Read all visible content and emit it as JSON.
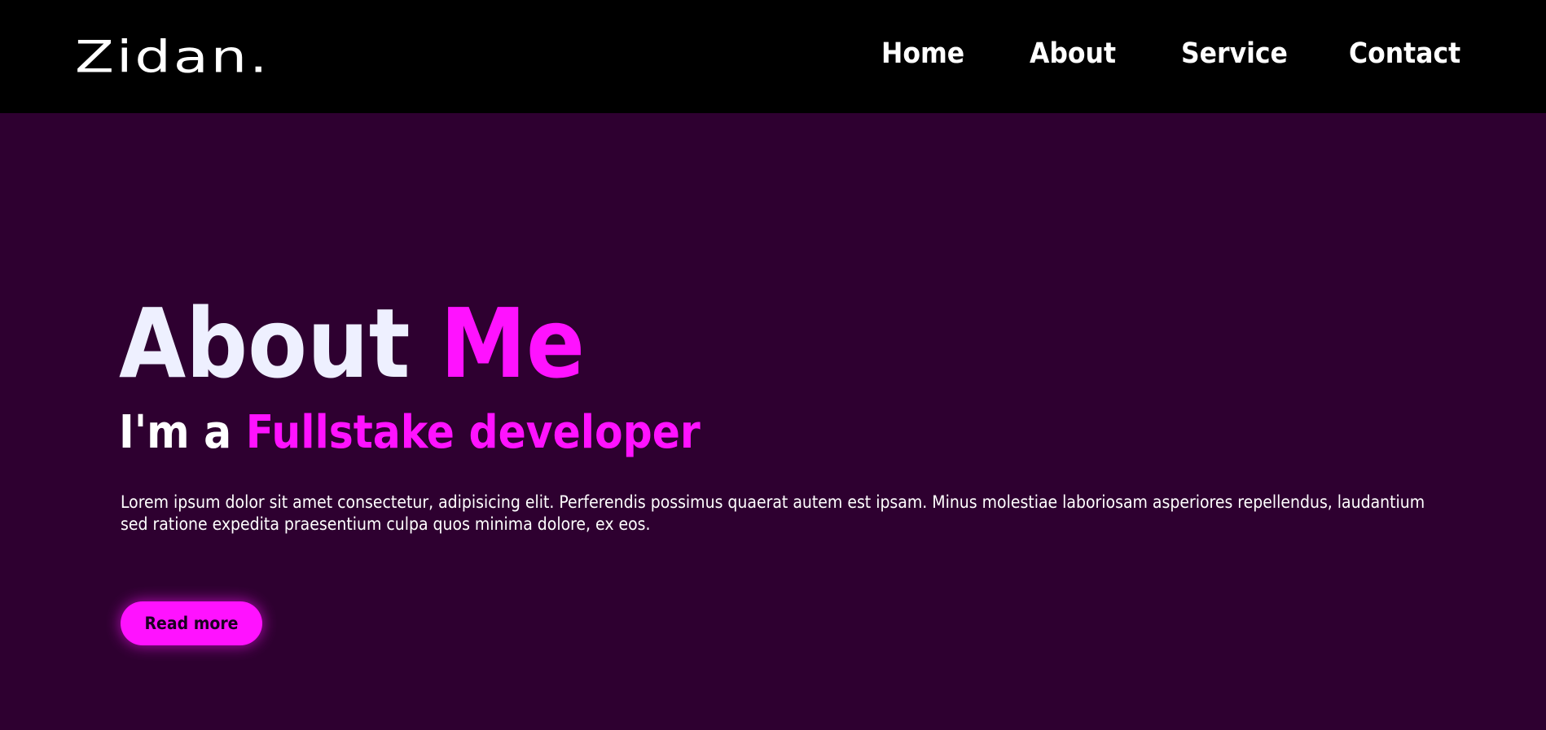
{
  "header": {
    "logo": "Zidan.",
    "nav": {
      "home": "Home",
      "about": "About",
      "service": "Service",
      "contact": "Contact"
    }
  },
  "hero": {
    "title_plain": "About ",
    "title_accent": "Me",
    "subtitle_plain": "I'm a ",
    "subtitle_accent": "Fullstake developer",
    "paragraph": "Lorem ipsum dolor sit amet consectetur, adipisicing elit. Perferendis possimus quaerat autem est ipsam. Minus molestiae laboriosam asperiores repellendus, laudantium sed ratione expedita praesentium culpa quos minima dolore, ex eos.",
    "button_label": "Read more"
  },
  "colors": {
    "navbar_bg": "#000000",
    "page_bg": "#2e0030",
    "accent": "#ff12ff",
    "text": "#ffffff"
  }
}
